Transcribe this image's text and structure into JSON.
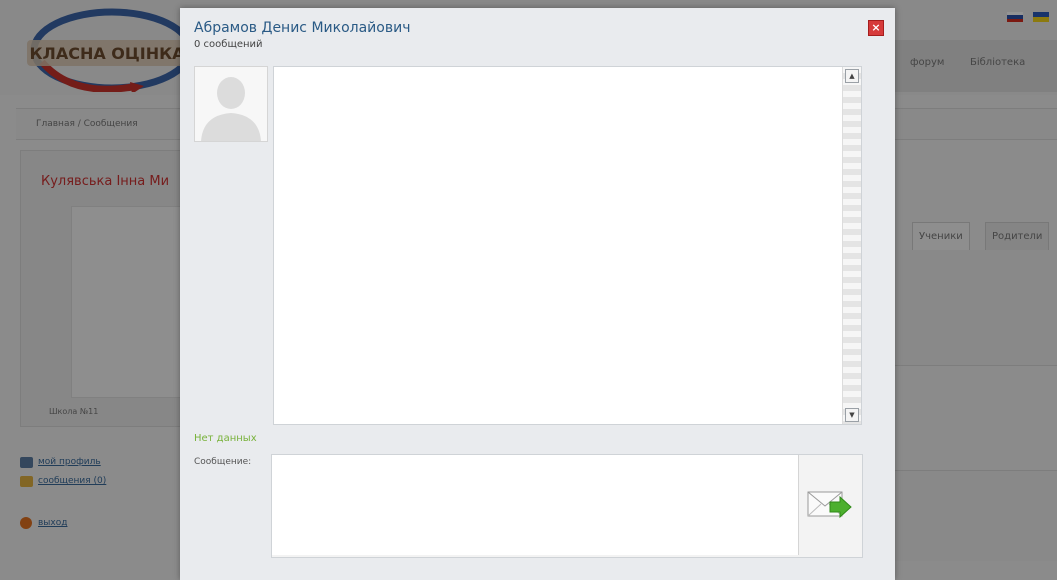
{
  "colors": {
    "accent": "#2a5a85",
    "profile_name": "#cc3333",
    "no_data": "#78b23a",
    "close": "#d63a3a"
  },
  "background": {
    "logo_text": "КЛАСНА ОЦІНКА",
    "nav": [
      "форум",
      "Бібліотека"
    ],
    "breadcrumb": "Главная / Сообщения",
    "profile": {
      "name": "Кулявська Інна Ми",
      "school": "Школа №11",
      "links": [
        {
          "label": "мой профиль",
          "icon": "profile-icon"
        },
        {
          "label": "сообщения (0)",
          "icon": "messages-icon"
        },
        {
          "label": "выход",
          "icon": "exit-icon"
        }
      ]
    },
    "tabs": [
      "Ученики",
      "Родители"
    ]
  },
  "modal": {
    "title": "Абрамов Денис Миколайович",
    "subtitle": "0 сообщений",
    "no_data": "Нет данных",
    "message_label": "Сообщение:",
    "message_value": "",
    "close_icon": "close-icon",
    "send_icon": "send-envelope-icon"
  }
}
